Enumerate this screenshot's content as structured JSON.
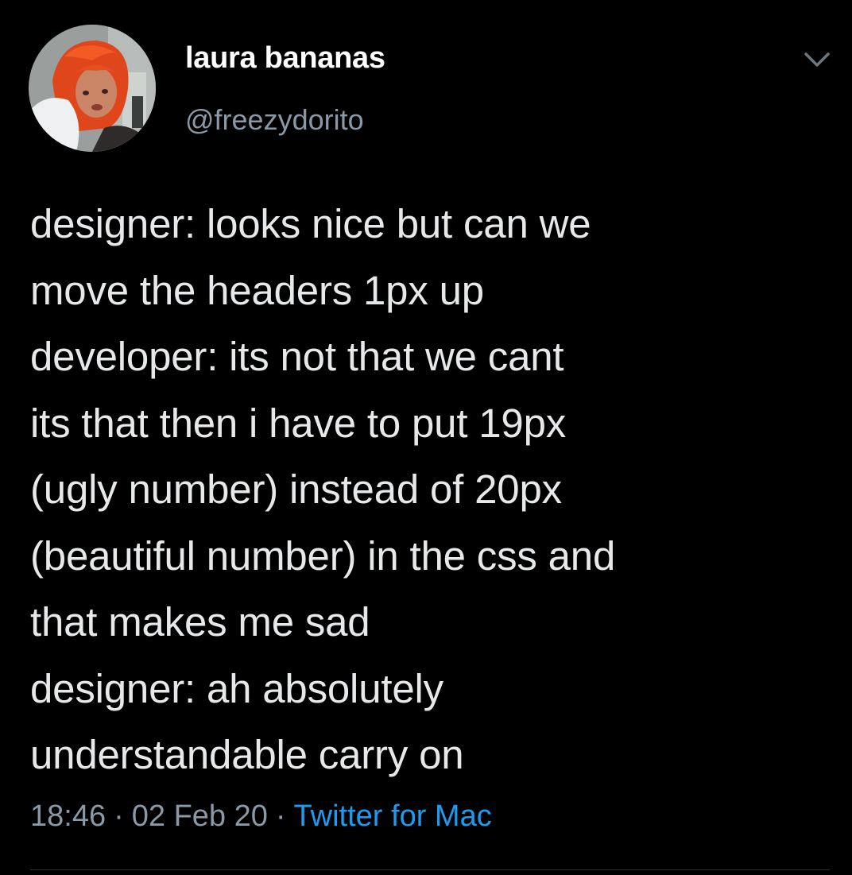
{
  "author": {
    "display_name": "laura bananas",
    "handle": "@freezydorito"
  },
  "tweet": {
    "lines": [
      "designer: looks nice but can we",
      "move the headers 1px up",
      "developer: its not that we cant",
      "its that then i have to put 19px",
      "(ugly number) instead of 20px",
      "(beautiful number) in the css and",
      "that makes me sad",
      "designer: ah absolutely",
      "understandable carry on"
    ]
  },
  "meta": {
    "time": "18:46",
    "separator": "·",
    "date": "02 Feb 20",
    "source": "Twitter for Mac"
  },
  "icons": {
    "menu": "chevron-down-icon",
    "avatar": "profile-photo"
  },
  "colors": {
    "background": "#000000",
    "text": "#e6e8ea",
    "secondary_text": "#8b98a5",
    "link": "#1d9bf0"
  }
}
